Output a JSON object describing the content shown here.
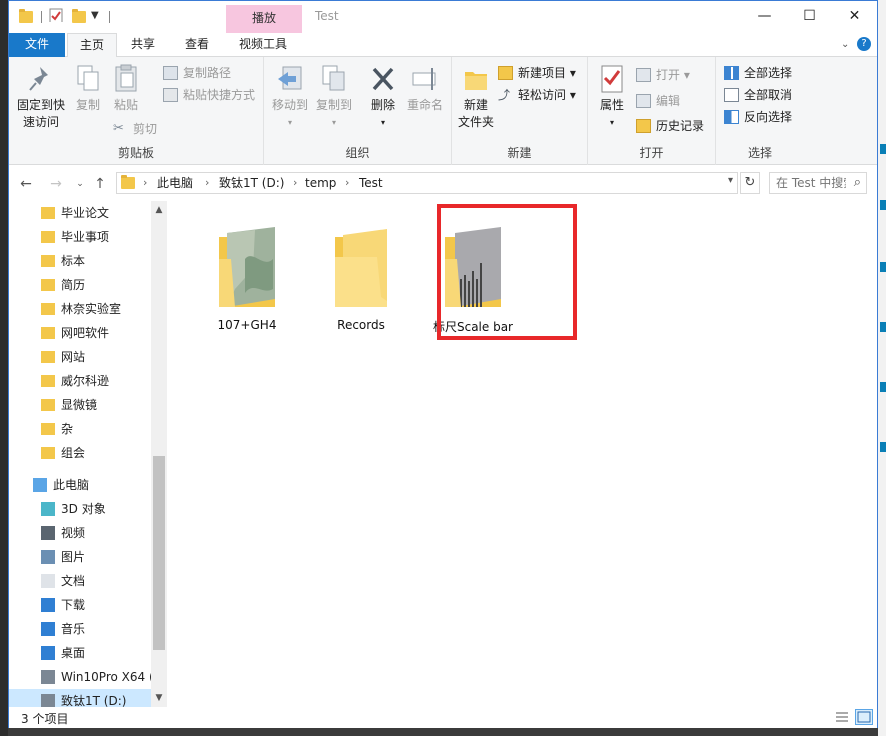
{
  "window": {
    "title": "Test",
    "context_tab_group": "播放",
    "minimize": "—",
    "maximize": "☐",
    "close": "✕"
  },
  "tabs": {
    "file": "文件",
    "home": "主页",
    "share": "共享",
    "view": "查看",
    "video_tools": "视频工具"
  },
  "ribbon": {
    "clipboard": {
      "group": "剪贴板",
      "pin_line1": "固定到快",
      "pin_line2": "速访问",
      "copy": "复制",
      "paste": "粘贴",
      "copy_path": "复制路径",
      "paste_shortcut": "粘贴快捷方式",
      "cut": "剪切"
    },
    "organize": {
      "group": "组织",
      "move_to": "移动到",
      "copy_to": "复制到",
      "delete": "删除",
      "rename": "重命名"
    },
    "new": {
      "group": "新建",
      "new_folder_line1": "新建",
      "new_folder_line2": "文件夹",
      "new_item": "新建项目 ▾",
      "easy_access": "轻松访问 ▾"
    },
    "open": {
      "group": "打开",
      "properties": "属性",
      "open": "打开 ▾",
      "edit": "编辑",
      "history": "历史记录"
    },
    "select": {
      "group": "选择",
      "select_all": "全部选择",
      "select_none": "全部取消",
      "invert": "反向选择"
    }
  },
  "address": {
    "crumbs": [
      "此电脑",
      "致钛1T (D:)",
      "temp",
      "Test"
    ],
    "search_placeholder": "在 Test 中搜索"
  },
  "sidebar": {
    "items": [
      {
        "label": "毕业论文",
        "icon": "folder-icon"
      },
      {
        "label": "毕业事项",
        "icon": "folder-icon"
      },
      {
        "label": "标本",
        "icon": "folder-icon"
      },
      {
        "label": "简历",
        "icon": "folder-icon"
      },
      {
        "label": "林奈实验室",
        "icon": "folder-icon"
      },
      {
        "label": "网吧软件",
        "icon": "folder-icon"
      },
      {
        "label": "网站",
        "icon": "folder-icon"
      },
      {
        "label": "威尔科逊",
        "icon": "folder-icon"
      },
      {
        "label": "显微镜",
        "icon": "folder-icon"
      },
      {
        "label": "杂",
        "icon": "folder-icon"
      },
      {
        "label": "组会",
        "icon": "folder-icon"
      },
      {
        "label": "此电脑",
        "icon": "computer-icon"
      },
      {
        "label": "3D 对象",
        "icon": "3d-objects-icon"
      },
      {
        "label": "视频",
        "icon": "videos-icon"
      },
      {
        "label": "图片",
        "icon": "pictures-icon"
      },
      {
        "label": "文档",
        "icon": "documents-icon"
      },
      {
        "label": "下载",
        "icon": "downloads-icon"
      },
      {
        "label": "音乐",
        "icon": "music-icon"
      },
      {
        "label": "桌面",
        "icon": "desktop-icon"
      },
      {
        "label": "Win10Pro X64 (",
        "icon": "drive-icon"
      },
      {
        "label": "致钛1T (D:)",
        "icon": "drive-icon"
      }
    ]
  },
  "content": {
    "items": [
      {
        "label": "107+GH4",
        "type": "folder-with-thumbnail"
      },
      {
        "label": "Records",
        "type": "folder"
      },
      {
        "label": "标尺Scale bar",
        "type": "folder-with-thumbnail"
      }
    ]
  },
  "status": {
    "count": "3 个项目"
  },
  "colors": {
    "accent": "#1979ca",
    "folder": "#f3c74a",
    "highlight": "#e8282a",
    "context_tab": "#f7c6df",
    "selected": "#cce8ff"
  }
}
